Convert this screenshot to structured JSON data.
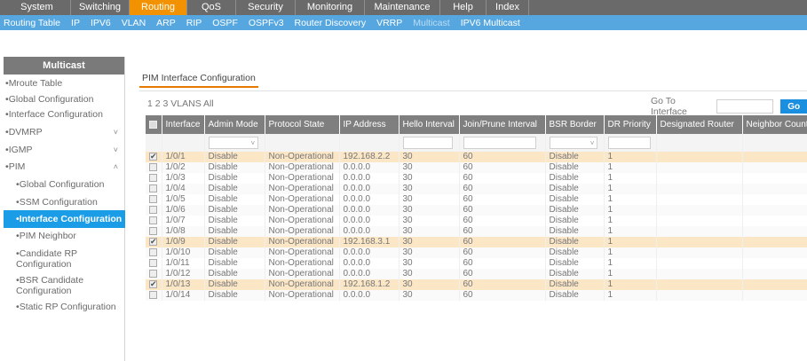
{
  "topnav": [
    {
      "label": "System",
      "active": false
    },
    {
      "label": "Switching",
      "active": false
    },
    {
      "label": "Routing",
      "active": true
    },
    {
      "label": "QoS",
      "active": false
    },
    {
      "label": "Security",
      "active": false
    },
    {
      "label": "Monitoring",
      "active": false
    },
    {
      "label": "Maintenance",
      "active": false
    },
    {
      "label": "Help",
      "active": false
    },
    {
      "label": "Index",
      "active": false
    }
  ],
  "subnav": [
    {
      "label": "Routing Table",
      "active": false
    },
    {
      "label": "IP",
      "active": false
    },
    {
      "label": "IPV6",
      "active": false
    },
    {
      "label": "VLAN",
      "active": false
    },
    {
      "label": "ARP",
      "active": false
    },
    {
      "label": "RIP",
      "active": false
    },
    {
      "label": "OSPF",
      "active": false
    },
    {
      "label": "OSPFv3",
      "active": false
    },
    {
      "label": "Router Discovery",
      "active": false
    },
    {
      "label": "VRRP",
      "active": false
    },
    {
      "label": "Multicast",
      "active": true
    },
    {
      "label": "IPV6 Multicast",
      "active": false
    }
  ],
  "sidebar": {
    "title": "Multicast",
    "items": [
      {
        "label": "Mroute Table",
        "sub": false,
        "chevron": ""
      },
      {
        "label": "Global Configuration",
        "sub": false,
        "chevron": ""
      },
      {
        "label": "Interface Configuration",
        "sub": false,
        "chevron": ""
      },
      {
        "label": "DVMRP",
        "sub": false,
        "chevron": "v"
      },
      {
        "label": "IGMP",
        "sub": false,
        "chevron": "v"
      },
      {
        "label": "PIM",
        "sub": false,
        "chevron": "^"
      },
      {
        "label": "Global Configuration",
        "sub": true,
        "chevron": ""
      },
      {
        "label": "SSM Configuration",
        "sub": true,
        "chevron": ""
      },
      {
        "label": "Interface Configuration",
        "sub": true,
        "chevron": "",
        "active": true
      },
      {
        "label": "PIM Neighbor",
        "sub": true,
        "chevron": ""
      },
      {
        "label": "Candidate RP Configuration",
        "sub": true,
        "chevron": ""
      },
      {
        "label": "BSR Candidate Configuration",
        "sub": true,
        "chevron": ""
      },
      {
        "label": "Static RP Configuration",
        "sub": true,
        "chevron": ""
      }
    ]
  },
  "main": {
    "tab_label": "PIM Interface Configuration",
    "filter_links": "1 2 3 VLANS All",
    "goto_label": "Go To Interface",
    "goto_value": "",
    "go_label": "Go"
  },
  "table": {
    "headers": [
      "Interface",
      "Admin Mode",
      "Protocol State",
      "IP Address",
      "Hello Interval",
      "Join/Prune Interval",
      "BSR Border",
      "DR Priority",
      "Designated Router",
      "Neighbor Count"
    ],
    "rows": [
      {
        "checked": true,
        "interface": "1/0/1",
        "admin_mode": "Disable",
        "protocol_state": "Non-Operational",
        "ip": "192.168.2.2",
        "hello": "30",
        "join_prune": "60",
        "bsr": "Disable",
        "dr_priority": "1",
        "designated_router": "",
        "neighbor_count": ""
      },
      {
        "checked": false,
        "interface": "1/0/2",
        "admin_mode": "Disable",
        "protocol_state": "Non-Operational",
        "ip": "0.0.0.0",
        "hello": "30",
        "join_prune": "60",
        "bsr": "Disable",
        "dr_priority": "1",
        "designated_router": "",
        "neighbor_count": ""
      },
      {
        "checked": false,
        "interface": "1/0/3",
        "admin_mode": "Disable",
        "protocol_state": "Non-Operational",
        "ip": "0.0.0.0",
        "hello": "30",
        "join_prune": "60",
        "bsr": "Disable",
        "dr_priority": "1",
        "designated_router": "",
        "neighbor_count": ""
      },
      {
        "checked": false,
        "interface": "1/0/4",
        "admin_mode": "Disable",
        "protocol_state": "Non-Operational",
        "ip": "0.0.0.0",
        "hello": "30",
        "join_prune": "60",
        "bsr": "Disable",
        "dr_priority": "1",
        "designated_router": "",
        "neighbor_count": ""
      },
      {
        "checked": false,
        "interface": "1/0/5",
        "admin_mode": "Disable",
        "protocol_state": "Non-Operational",
        "ip": "0.0.0.0",
        "hello": "30",
        "join_prune": "60",
        "bsr": "Disable",
        "dr_priority": "1",
        "designated_router": "",
        "neighbor_count": ""
      },
      {
        "checked": false,
        "interface": "1/0/6",
        "admin_mode": "Disable",
        "protocol_state": "Non-Operational",
        "ip": "0.0.0.0",
        "hello": "30",
        "join_prune": "60",
        "bsr": "Disable",
        "dr_priority": "1",
        "designated_router": "",
        "neighbor_count": ""
      },
      {
        "checked": false,
        "interface": "1/0/7",
        "admin_mode": "Disable",
        "protocol_state": "Non-Operational",
        "ip": "0.0.0.0",
        "hello": "30",
        "join_prune": "60",
        "bsr": "Disable",
        "dr_priority": "1",
        "designated_router": "",
        "neighbor_count": ""
      },
      {
        "checked": false,
        "interface": "1/0/8",
        "admin_mode": "Disable",
        "protocol_state": "Non-Operational",
        "ip": "0.0.0.0",
        "hello": "30",
        "join_prune": "60",
        "bsr": "Disable",
        "dr_priority": "1",
        "designated_router": "",
        "neighbor_count": ""
      },
      {
        "checked": true,
        "interface": "1/0/9",
        "admin_mode": "Disable",
        "protocol_state": "Non-Operational",
        "ip": "192.168.3.1",
        "hello": "30",
        "join_prune": "60",
        "bsr": "Disable",
        "dr_priority": "1",
        "designated_router": "",
        "neighbor_count": ""
      },
      {
        "checked": false,
        "interface": "1/0/10",
        "admin_mode": "Disable",
        "protocol_state": "Non-Operational",
        "ip": "0.0.0.0",
        "hello": "30",
        "join_prune": "60",
        "bsr": "Disable",
        "dr_priority": "1",
        "designated_router": "",
        "neighbor_count": ""
      },
      {
        "checked": false,
        "interface": "1/0/11",
        "admin_mode": "Disable",
        "protocol_state": "Non-Operational",
        "ip": "0.0.0.0",
        "hello": "30",
        "join_prune": "60",
        "bsr": "Disable",
        "dr_priority": "1",
        "designated_router": "",
        "neighbor_count": ""
      },
      {
        "checked": false,
        "interface": "1/0/12",
        "admin_mode": "Disable",
        "protocol_state": "Non-Operational",
        "ip": "0.0.0.0",
        "hello": "30",
        "join_prune": "60",
        "bsr": "Disable",
        "dr_priority": "1",
        "designated_router": "",
        "neighbor_count": ""
      },
      {
        "checked": true,
        "interface": "1/0/13",
        "admin_mode": "Disable",
        "protocol_state": "Non-Operational",
        "ip": "192.168.1.2",
        "hello": "30",
        "join_prune": "60",
        "bsr": "Disable",
        "dr_priority": "1",
        "designated_router": "",
        "neighbor_count": ""
      },
      {
        "checked": false,
        "interface": "1/0/14",
        "admin_mode": "Disable",
        "protocol_state": "Non-Operational",
        "ip": "0.0.0.0",
        "hello": "30",
        "join_prune": "60",
        "bsr": "Disable",
        "dr_priority": "1",
        "designated_router": "",
        "neighbor_count": ""
      }
    ]
  },
  "colors": {
    "topnav_bg": "#6a6a6a",
    "topnav_active": "#f39200",
    "subnav_bg": "#56a7e0",
    "sidebar_active": "#1a9ce6",
    "selected_row": "#fbe6c6",
    "go_button": "#1a8fdf"
  }
}
